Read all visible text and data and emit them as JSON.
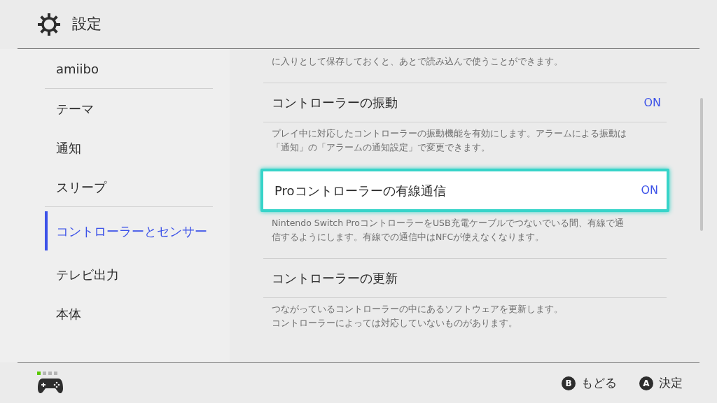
{
  "header": {
    "title": "設定"
  },
  "sidebar": {
    "items": [
      {
        "label": "amiibo",
        "selected": false,
        "divider_after": true
      },
      {
        "label": "テーマ",
        "selected": false,
        "divider_after": false
      },
      {
        "label": "通知",
        "selected": false,
        "divider_after": false
      },
      {
        "label": "スリープ",
        "selected": false,
        "divider_after": true
      },
      {
        "label": "コントローラーとセンサー",
        "selected": true,
        "divider_after": false
      },
      {
        "label": "テレビ出力",
        "selected": false,
        "divider_after": false
      },
      {
        "label": "本体",
        "selected": false,
        "divider_after": false
      }
    ]
  },
  "content": {
    "blocks": [
      {
        "kind": "description",
        "lines": [
          "に入りとして保存しておくと、あとで読み込んで使うことができます。"
        ]
      },
      {
        "kind": "setting",
        "title": "コントローラーの振動",
        "value": "ON",
        "selected": false,
        "lines": [
          "プレイ中に対応したコントローラーの振動機能を有効にします。アラームによる振動は",
          "「通知」の「アラームの通知設定」で変更できます。"
        ]
      },
      {
        "kind": "setting",
        "title": "Proコントローラーの有線通信",
        "value": "ON",
        "selected": true,
        "lines": [
          "Nintendo Switch ProコントローラーをUSB充電ケーブルでつないでいる間、有線で通",
          "信するようにします。有線での通信中はNFCが使えなくなります。"
        ]
      },
      {
        "kind": "setting",
        "title": "コントローラーの更新",
        "selected": false,
        "lines": [
          "つながっているコントローラーの中にあるソフトウェアを更新します。",
          "コントローラーによっては対応していないものがあります。"
        ]
      }
    ]
  },
  "footer": {
    "player_indicator": [
      true,
      false,
      false,
      false
    ],
    "buttons": [
      {
        "key": "B",
        "label": "もどる"
      },
      {
        "key": "A",
        "label": "決定"
      }
    ]
  }
}
